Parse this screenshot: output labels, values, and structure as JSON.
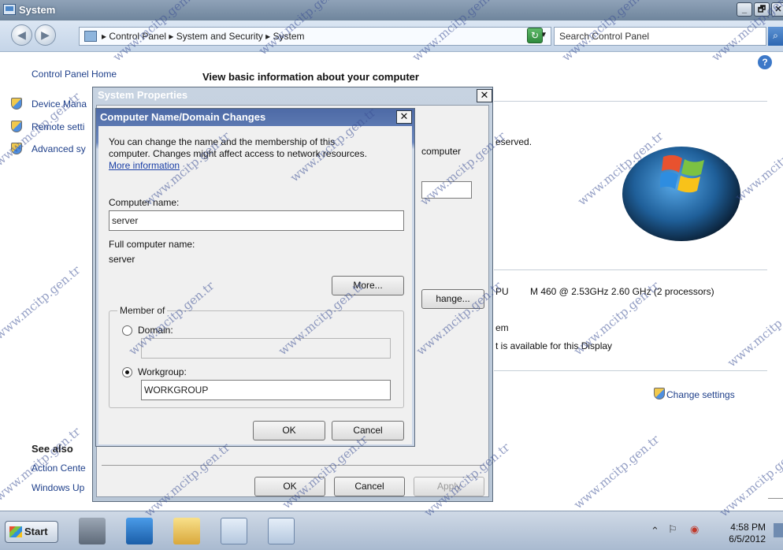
{
  "window": {
    "title": "System",
    "controls": [
      "_",
      "🗗",
      "✕"
    ]
  },
  "address": {
    "crumbs": "▸ Control Panel ▸ System and Security ▸ System",
    "search_placeholder": "Search Control Panel"
  },
  "sidebar": {
    "home": "Control Panel Home",
    "items": [
      "Device Mana",
      "Remote setti",
      "Advanced sy"
    ]
  },
  "main": {
    "heading": "View basic information about your computer",
    "fragments": {
      "reserved": "eserved.",
      "computer": "computer",
      "cpu_prefix": "PU",
      "cpu": "M 460  @ 2.53GHz  2.60 GHz  (2 processors)",
      "em": "em",
      "display": "t is available for this Display",
      "change_settings": "Change settings",
      "change_btn": "hange..."
    },
    "see_also": {
      "title": "See also",
      "items": [
        "Action Cente",
        "Windows Up"
      ]
    }
  },
  "system_properties": {
    "title": "System Properties",
    "close": "✕",
    "buttons": {
      "ok": "OK",
      "cancel": "Cancel",
      "apply": "Apply"
    }
  },
  "computer_name_dialog": {
    "title": "Computer Name/Domain Changes",
    "close": "✕",
    "intro_line1": "You can change the name and the membership of this",
    "intro_line2": "computer. Changes might affect access to network resources.",
    "more_info_link": "More information",
    "computer_name_label": "Computer name:",
    "computer_name_value": "server",
    "full_name_label": "Full computer name:",
    "full_name_value": "server",
    "more_button": "More...",
    "member_of_label": "Member of",
    "domain_label": "Domain:",
    "domain_value": "",
    "workgroup_label": "Workgroup:",
    "workgroup_value": "WORKGROUP",
    "selected_membership": "Workgroup",
    "ok_button": "OK",
    "cancel_button": "Cancel"
  },
  "taskbar": {
    "start": "Start",
    "clock_time": "4:58 PM",
    "clock_date": "6/5/2012"
  },
  "watermark": "www.mcitp.gen.tr",
  "colors": {
    "link": "#1e3f8a",
    "titlebar": "#6f859c",
    "dialog_title": "#4d6aa6"
  }
}
